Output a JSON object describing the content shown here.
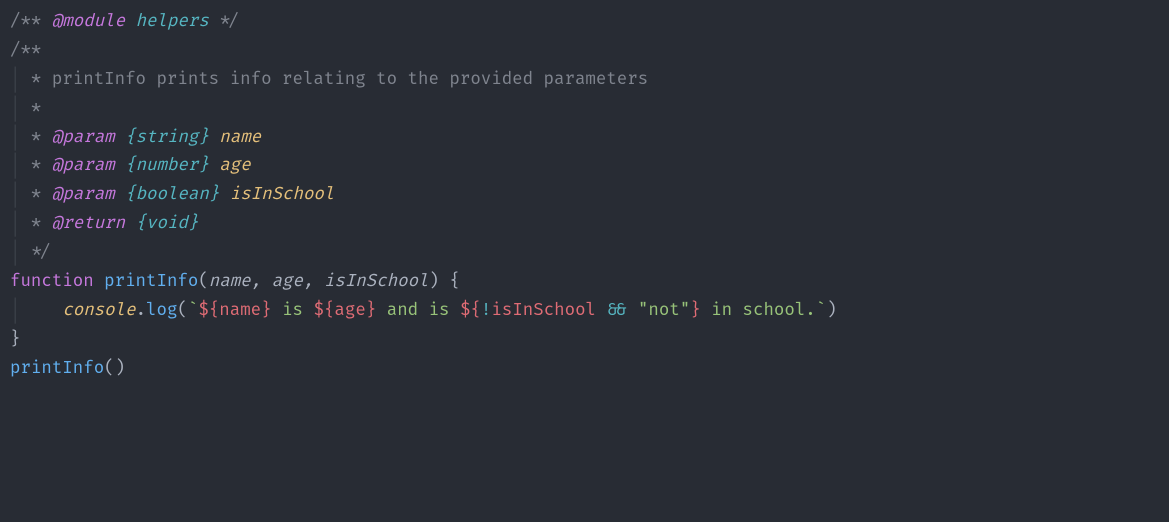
{
  "l1": {
    "open": "/** ",
    "tag": "@module",
    "space": " ",
    "name": "helpers",
    "close": " */"
  },
  "l2": "",
  "l3": {
    "open": "/**"
  },
  "l4": {
    "pre": " * ",
    "text": "printInfo prints info relating to the provided parameters"
  },
  "l5": {
    "pre": " *"
  },
  "l6": {
    "pre": " * ",
    "tag": "@param",
    "space": " ",
    "type": "{string}",
    "space2": " ",
    "name": "name"
  },
  "l7": {
    "pre": " * ",
    "tag": "@param",
    "space": " ",
    "type": "{number}",
    "space2": " ",
    "name": "age"
  },
  "l8": {
    "pre": " * ",
    "tag": "@param",
    "space": " ",
    "type": "{boolean}",
    "space2": " ",
    "name": "isInSchool"
  },
  "l9": {
    "pre": " * ",
    "tag": "@return",
    "space": " ",
    "type": "{void}"
  },
  "l10": {
    "pre": " */"
  },
  "l11": {
    "kw": "function",
    "sp": " ",
    "fn": "printInfo",
    "op": "(",
    "a1": "name",
    "c1": ", ",
    "a2": "age",
    "c2": ", ",
    "a3": "isInSchool",
    "cp": ") ",
    "ob": "{"
  },
  "l12": {
    "indent": "    ",
    "obj": "console",
    "dot": ".",
    "method": "log",
    "op": "(",
    "bt1": "`",
    "id1o": "${",
    "iv1": "name",
    "id1c": "}",
    "t1": " is ",
    "id2o": "${",
    "iv2": "age",
    "id2c": "}",
    "t2": " and is ",
    "id3o": "${",
    "neg": "!",
    "iv3": "isInSchool",
    "sp3": " ",
    "and": "&&",
    "sp4": " ",
    "q1": "\"",
    "str": "not",
    "q2": "\"",
    "id3c": "}",
    "t3": " in school.",
    "bt2": "`",
    "cp": ")"
  },
  "l13": {
    "cb": "}"
  },
  "l14": "",
  "l15": {
    "fn": "printInfo",
    "op": "(",
    "cp": ")"
  }
}
